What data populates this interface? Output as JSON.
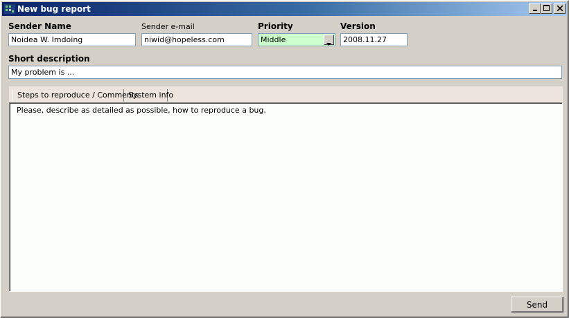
{
  "window": {
    "title": "New bug report",
    "icon": "bug-report-app-icon",
    "controls": [
      "minimize",
      "maximize",
      "close"
    ]
  },
  "form": {
    "sender_name_label": "Sender Name",
    "sender_name_value": "Noidea W. Imdoing",
    "sender_email_label": "Sender e-mail",
    "sender_email_value": "niwid@hopeless.com",
    "priority_label": "Priority",
    "priority_value": "Middle",
    "version_label": "Version",
    "version_value": "2008.11.27",
    "short_description_label": "Short description",
    "short_description_value": "My problem is ..."
  },
  "tabs": [
    {
      "label": "Steps to reproduce / Comments",
      "active": true
    },
    {
      "label": "System info",
      "active": false
    }
  ],
  "details": {
    "text": "Please, describe as detailed as possible, how to reproduce a bug."
  },
  "actions": {
    "send_label": "Send"
  },
  "colors": {
    "titlebar_start": "#0a246a",
    "titlebar_end": "#a6caf0",
    "priority_field_bg": "#ccffcc",
    "window_bg": "#d4d0c8"
  }
}
